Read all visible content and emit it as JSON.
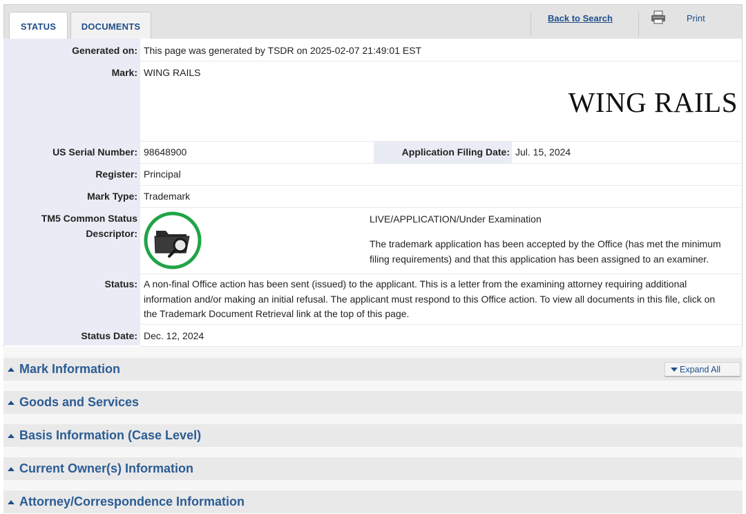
{
  "tabs": {
    "status": "STATUS",
    "documents": "DOCUMENTS"
  },
  "toolbar": {
    "back_to_search": "Back to Search",
    "print": "Print",
    "print_icon": "printer-icon"
  },
  "fields": {
    "generated_on": {
      "label": "Generated on:",
      "value": "This page was generated by TSDR on 2025-02-07 21:49:01 EST"
    },
    "mark": {
      "label": "Mark:",
      "value": "WING RAILS",
      "image_text": "WING RAILS"
    },
    "serial": {
      "label": "US Serial Number:",
      "value": "98648900"
    },
    "filing_date": {
      "label": "Application Filing Date:",
      "value": "Jul. 15, 2024"
    },
    "register": {
      "label": "Register:",
      "value": "Principal"
    },
    "mark_type": {
      "label": "Mark Type:",
      "value": "Trademark"
    },
    "tm5": {
      "label_line1": "TM5 Common Status",
      "label_line2": "Descriptor:",
      "icon": "folder-search-icon",
      "icon_ring_color": "#1fa447",
      "status_line": "LIVE/APPLICATION/Under Examination",
      "description_line1": "The trademark application has been accepted by the Office (has met the minimum",
      "description_line2": "filing requirements) and that this application has been assigned to an examiner."
    },
    "status": {
      "label": "Status:",
      "line1": "A non-final Office action has been sent (issued) to the applicant. This is a letter from the examining attorney requiring additional",
      "line2": "information and/or making an initial refusal. The applicant must respond to this Office action. To view all documents in this file, click on",
      "line3": "the Trademark Document Retrieval link at the top of this page."
    },
    "status_date": {
      "label": "Status Date:",
      "value": "Dec. 12, 2024"
    }
  },
  "sections": [
    {
      "title": "Mark Information"
    },
    {
      "title": "Goods and Services"
    },
    {
      "title": "Basis Information (Case Level)"
    },
    {
      "title": "Current Owner(s) Information"
    },
    {
      "title": "Attorney/Correspondence Information"
    }
  ],
  "expand_all": "Expand All",
  "colors": {
    "link": "#1f4e8a",
    "section_title": "#2b5c94",
    "label_column": "#e9ecf4",
    "section_bg": "#e9e9e9"
  }
}
